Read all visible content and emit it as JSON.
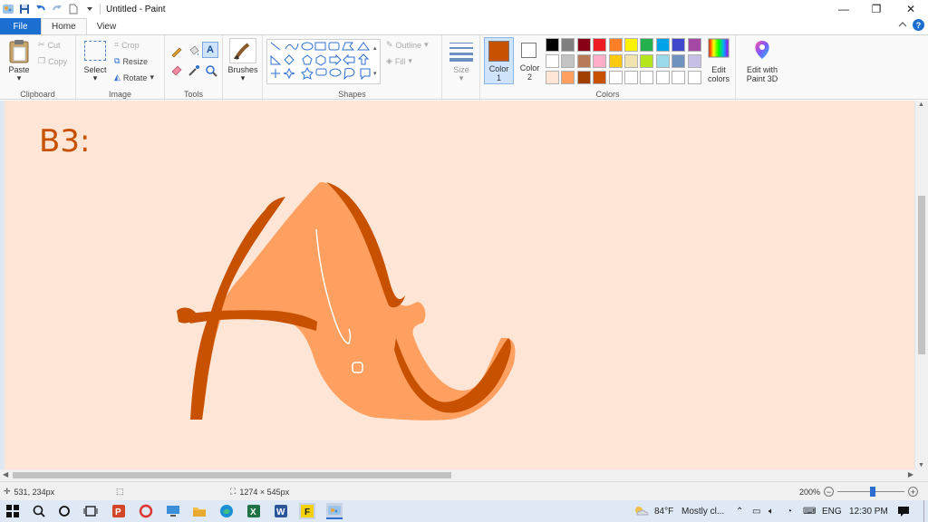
{
  "window": {
    "title": "Untitled - Paint",
    "minimize_symbol": "—",
    "restore_symbol": "❐",
    "close_symbol": "✕"
  },
  "tabs": [
    {
      "label": "File"
    },
    {
      "label": "Home"
    },
    {
      "label": "View"
    }
  ],
  "ribbon": {
    "clipboard": {
      "label": "Clipboard",
      "paste": "Paste",
      "cut": "Cut",
      "copy": "Copy"
    },
    "image": {
      "label": "Image",
      "select": "Select",
      "crop": "Crop",
      "resize": "Resize",
      "rotate": "Rotate"
    },
    "tools": {
      "label": "Tools"
    },
    "brushes": {
      "label": "Brushes"
    },
    "shapes": {
      "label": "Shapes",
      "outline": "Outline",
      "fill": "Fill"
    },
    "size": {
      "label": "Size"
    },
    "colors": {
      "label": "Colors",
      "color1": "Color 1",
      "color1_line1": "Color",
      "color1_line2": "1",
      "color2_line1": "Color",
      "color2_line2": "2",
      "color1_value": "#c85100",
      "color2_value": "#ffffff",
      "edit_colors_line1": "Edit",
      "edit_colors_line2": "colors",
      "palette_row1": [
        "#000000",
        "#7f7f7f",
        "#880015",
        "#ed1c24",
        "#ff7f27",
        "#fff200",
        "#22b14c",
        "#00a2e8",
        "#3f48cc",
        "#a349a4"
      ],
      "palette_row2": [
        "#ffffff",
        "#c3c3c3",
        "#b97a57",
        "#ffaec9",
        "#ffc90e",
        "#efe4b0",
        "#b5e61d",
        "#99d9ea",
        "#7092be",
        "#c8bfe7"
      ],
      "palette_row3": [
        "#ffe5d6",
        "#ff9f60",
        "#a04000",
        "#c85100",
        "#ffffff",
        "#ffffff",
        "#ffffff",
        "#ffffff",
        "#ffffff",
        "#ffffff"
      ]
    },
    "paint3d": {
      "line1": "Edit with",
      "line2": "Paint 3D"
    }
  },
  "canvas": {
    "background": "#ffe5d6",
    "text": "B3:",
    "text_color": "#c85100",
    "light_orange": "#ff9f60",
    "dark_orange": "#c85100"
  },
  "status": {
    "cursor_pos": "531, 234px",
    "image_size": "1274 × 545px",
    "zoom": "200%"
  },
  "taskbar": {
    "weather_temp": "84°F",
    "weather_text": "Mostly cl...",
    "language": "ENG",
    "time": "12:30 PM"
  }
}
